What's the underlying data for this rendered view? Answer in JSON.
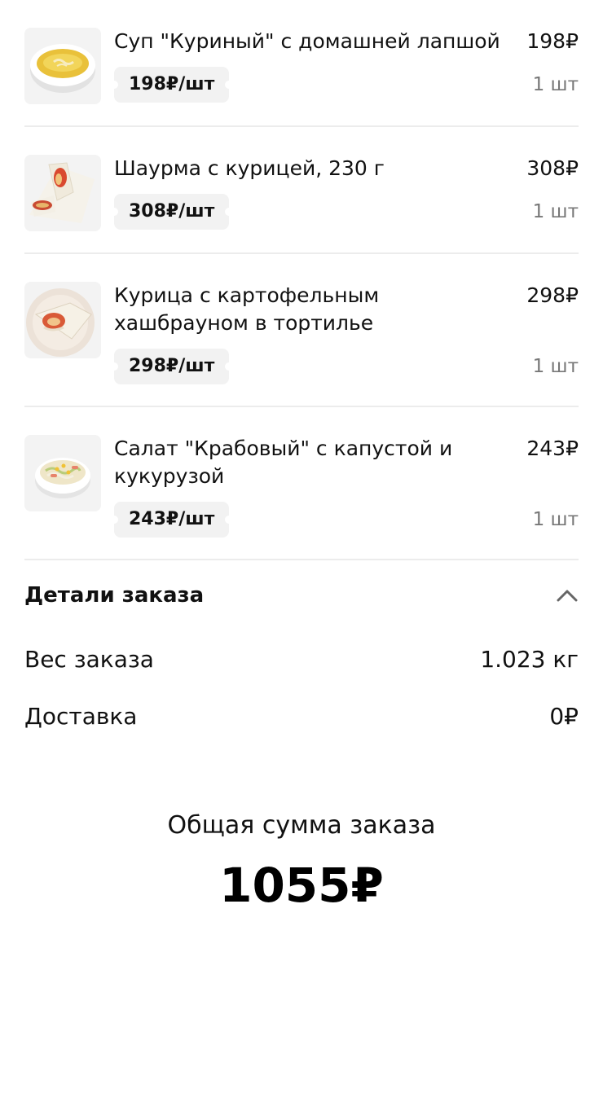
{
  "items": [
    {
      "name": "Суп \"Куриный\" с домашней лапшой",
      "price": "198₽",
      "unit_price": "198₽/шт",
      "qty": "1 шт",
      "image": "soup-bowl-image"
    },
    {
      "name": "Шаурма с курицей, 230 г",
      "price": "308₽",
      "unit_price": "308₽/шт",
      "qty": "1 шт",
      "image": "shawarma-image"
    },
    {
      "name": "Курица с картофельным хашбрауном в тортилье",
      "price": "298₽",
      "unit_price": "298₽/шт",
      "qty": "1 шт",
      "image": "tortilla-plate-image"
    },
    {
      "name": "Салат \"Крабовый\" с капустой и кукурузой",
      "price": "243₽",
      "unit_price": "243₽/шт",
      "qty": "1 шт",
      "image": "salad-bowl-image"
    }
  ],
  "details": {
    "title": "Детали заказа",
    "toggle_icon": "chevron-up-icon",
    "weight_label": "Вес заказа",
    "weight_value": "1.023 кг",
    "delivery_label": "Доставка",
    "delivery_value": "0₽"
  },
  "total": {
    "label": "Общая сумма заказа",
    "value": "1055₽"
  }
}
